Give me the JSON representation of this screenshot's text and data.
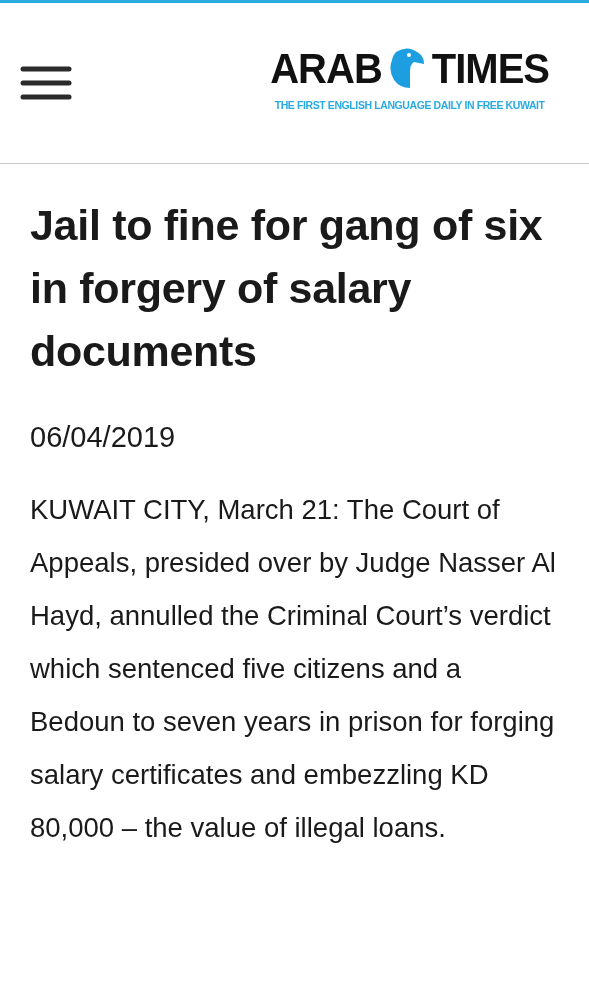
{
  "header": {
    "logo": {
      "word_1": "ARAB",
      "word_2": "TIMES",
      "tagline": "THE FIRST ENGLISH LANGUAGE DAILY IN FREE KUWAIT"
    }
  },
  "article": {
    "title": "Jail to fine for gang of six in forgery of salary documents",
    "date": "06/04/2019",
    "body": "KUWAIT CITY, March 21: The Court of Appeals, presided over by Judge Nasser Al Hayd, annulled the Criminal Court’s verdict which sentenced five citizens and a Bedoun to seven years in prison for forging salary certificates and embezzling KD 80,000 – the value of illegal loans."
  }
}
